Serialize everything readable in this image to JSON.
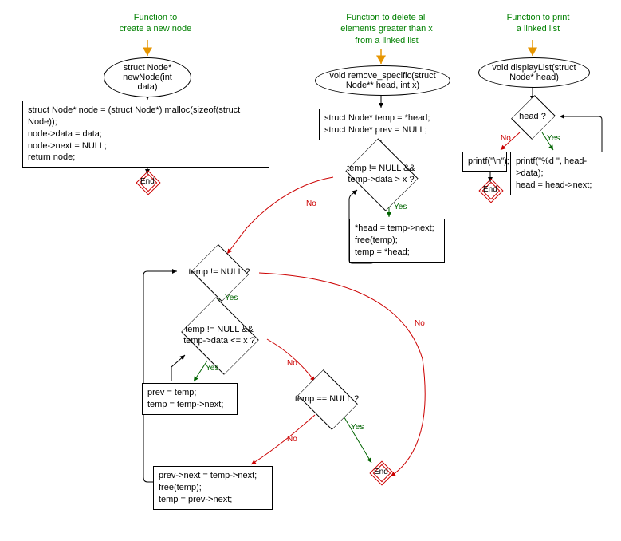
{
  "flowchart1": {
    "title": "Function to\ncreate a new node",
    "start": "struct Node*\nnewNode(int data)",
    "p1": "struct Node* node = (struct Node*) malloc(sizeof(struct\nNode));\nnode->data = data;\nnode->next = NULL;\nreturn node;",
    "end": "End"
  },
  "flowchart2": {
    "title": "Function to delete all\nelements greater than x\nfrom a linked list",
    "start": "void remove_specific(struct\nNode** head, int x)",
    "p1": "struct Node* temp = *head;\nstruct Node* prev = NULL;",
    "d1": "temp != NULL &&\ntemp->data > x ?",
    "p2": "*head = temp->next;\nfree(temp);\ntemp = *head;",
    "d2": "temp != NULL ?",
    "d3": "temp != NULL &&\ntemp->data <= x ?",
    "p3": "prev = temp;\ntemp = temp->next;",
    "d4": "temp == NULL ?",
    "p4": "prev->next = temp->next;\nfree(temp);\ntemp = prev->next;",
    "end": "End",
    "yes": "Yes",
    "no": "No"
  },
  "flowchart3": {
    "title": "Function to print\na linked list",
    "start": "void displayList(struct\nNode* head)",
    "d1": "head ?",
    "p1": "printf(\"%d \", head->data);\nhead = head->next;",
    "p2": "printf(\"\\n\");",
    "end": "End",
    "yes": "Yes",
    "no": "No"
  }
}
